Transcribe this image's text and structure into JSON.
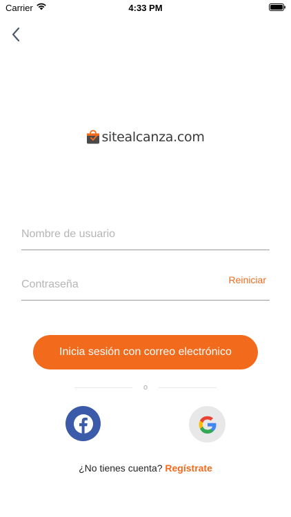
{
  "status_bar": {
    "carrier": "Carrier",
    "time": "4:33 PM"
  },
  "logo": {
    "text": "sitealcanza.com",
    "brand_color": "#f26b1d"
  },
  "form": {
    "username_placeholder": "Nombre de usuario",
    "password_placeholder": "Contraseña",
    "reset_label": "Reiniciar",
    "login_label": "Inicia sesión con correo electrónico"
  },
  "divider": {
    "text": "o"
  },
  "social": {
    "facebook_icon": "facebook-icon",
    "google_icon": "google-icon"
  },
  "signup": {
    "prompt": "¿No tienes cuenta?",
    "link": "Regístrate"
  },
  "colors": {
    "accent": "#f26b1d",
    "facebook": "#3b5aa9",
    "google_bg": "#e8e8e8"
  }
}
